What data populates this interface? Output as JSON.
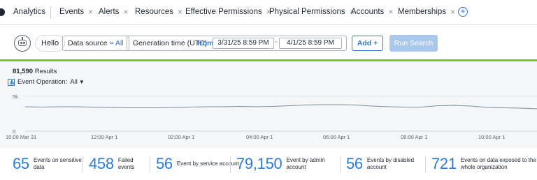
{
  "tabs": {
    "app": "Analytics",
    "items": [
      {
        "label": "Events"
      },
      {
        "label": "Alerts"
      },
      {
        "label": "Resources"
      },
      {
        "label": "Effective Permissions"
      },
      {
        "label": "Physical Permissions"
      },
      {
        "label": "Accounts"
      },
      {
        "label": "Memberships"
      }
    ],
    "add_icon": "plus-circle-icon"
  },
  "toolbar": {
    "greeting": "Hello",
    "data_source_label": "Data source",
    "data_source_value": "= All",
    "generation_time_label": "Generation time (UTC)",
    "from_label": "from",
    "from_value": "3/31/25  8:59 PM",
    "range_separator": "-",
    "to_value": "4/1/25  8:59 PM",
    "add_label": "Add +",
    "run_label": "Run Search"
  },
  "results": {
    "count": "81,590",
    "count_suffix": " Results",
    "operation_label": "Event Operation:",
    "operation_value": "All"
  },
  "chart_data": {
    "type": "line",
    "y_ticks": [
      "5k",
      "0"
    ],
    "ylim": [
      0,
      5000
    ],
    "x_tick_labels": [
      "10:00 Mar 31",
      "12:00 Apr 1",
      "02:00 Apr 1",
      "04:00 Apr 1",
      "06:00 Apr 1",
      "08:00 Apr 1",
      "10:00 Apr 1"
    ],
    "series": [
      {
        "values": [
          3500,
          3450,
          3500,
          3500,
          3450,
          3400,
          3350,
          3350,
          3350,
          3400,
          3450,
          3500,
          3500,
          3550,
          3500,
          3550,
          3650,
          3750,
          3800,
          3800,
          3750,
          3600,
          3500,
          3450,
          3450,
          3650,
          3700,
          3600,
          3400,
          3350,
          3300,
          3200
        ]
      }
    ],
    "color": "#7f8c9a"
  },
  "stats": [
    {
      "value": "65",
      "label": "Events on sensitive data"
    },
    {
      "value": "458",
      "label": "Failed events"
    },
    {
      "value": "56",
      "label": "Event by service account"
    },
    {
      "value": "79,150",
      "label": "Event by admin account"
    },
    {
      "value": "56",
      "label": "Events by disabled account"
    },
    {
      "value": "721",
      "label": "Events on data exposed to the whole organization"
    }
  ],
  "colors": {
    "accent": "#2e7bd6",
    "highlight_bar": "#78c43a",
    "run_button_disabled": "#a9c9ec"
  }
}
